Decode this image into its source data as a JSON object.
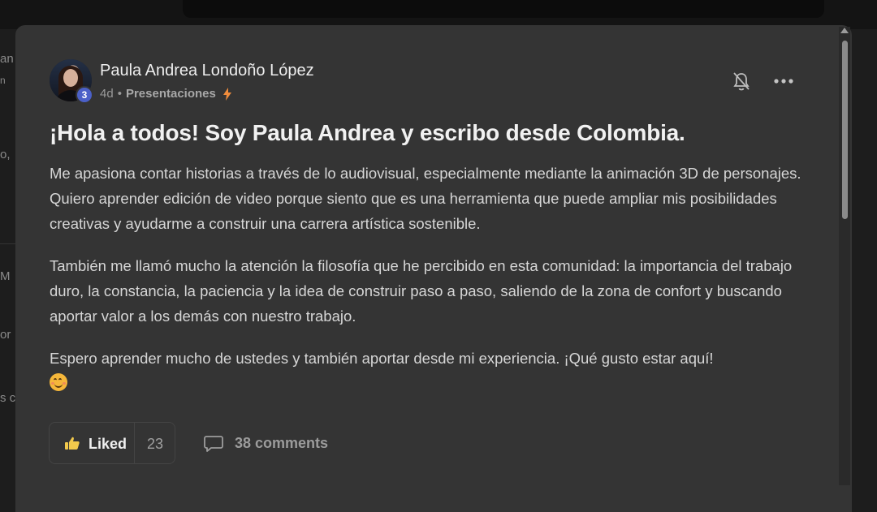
{
  "post": {
    "author": "Paula Andrea Londoño López",
    "level": "3",
    "time_ago": "4d",
    "separator": "•",
    "category": "Presentaciones",
    "title": "¡Hola a todos! Soy Paula Andrea y escribo desde Colombia.",
    "paragraphs": [
      "Me apasiona contar historias a través de lo audiovisual, especialmente mediante la animación 3D de personajes. Quiero aprender edición de video porque siento que es una herramienta que puede ampliar mis posibilidades creativas y ayudarme a construir una carrera artística sostenible.",
      "También me llamó mucho la atención la filosofía que he percibido en esta comunidad: la importancia del trabajo duro, la constancia, la paciencia y la idea de construir paso a paso, saliendo de la zona de confort y buscando aportar valor a los demás con nuestro trabajo.",
      "Espero aprender mucho de ustedes y también aportar desde mi experiencia. ¡Qué gusto estar aquí!"
    ],
    "emoji": "smiling-face-emoji"
  },
  "actions": {
    "liked_label": "Liked",
    "like_count": "23",
    "comments_label": "38 comments"
  },
  "icons": {
    "bell": "bell-off-icon",
    "more": "more-horizontal-icon",
    "like": "thumbs-up-icon",
    "comment": "comment-icon",
    "bolt": "lightning-icon"
  },
  "colors": {
    "modal_bg": "#343434",
    "page_bg": "#1d1d1d",
    "level_badge": "#4b60c8",
    "bolt": "#f08c3c"
  }
}
